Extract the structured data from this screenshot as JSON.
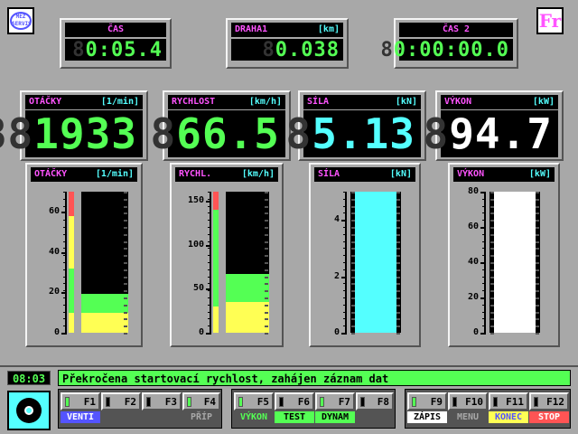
{
  "top": {
    "cas": {
      "label": "ČAS",
      "value": "0:05.4",
      "ghost": "8"
    },
    "draha": {
      "label": "DRAHA1",
      "unit": "[km]",
      "value": "0.038",
      "ghost": "8"
    },
    "cas2": {
      "label": "ČAS 2",
      "value": "0:00:00.0",
      "ghost": "8"
    }
  },
  "big": {
    "otacky": {
      "label": "OTÁČKY",
      "unit": "[1/min]",
      "value": "1933",
      "ghost": "88",
      "color": "#54ff54"
    },
    "rychlost": {
      "label": "RYCHLOST",
      "unit": "[km/h]",
      "value": "66.5",
      "ghost": "8",
      "color": "#54ff54"
    },
    "sila": {
      "label": "SÍLA",
      "unit": "[kN]",
      "value": "5.13",
      "ghost": "8",
      "color": "#54ffff"
    },
    "vykon": {
      "label": "VÝKON",
      "unit": "[kW]",
      "value": "94.7",
      "ghost": "8",
      "color": "#ffffff"
    }
  },
  "gauges": {
    "otacky": {
      "label": "OTÁČKY",
      "unit": "[1/min]",
      "ticks": [
        "60",
        "40",
        "20",
        "0"
      ],
      "max": 70,
      "value": 19.3
    },
    "rychl": {
      "label": "RYCHL.",
      "unit": "[km/h]",
      "ticks": [
        "150",
        "100",
        "50",
        "0"
      ],
      "max": 160,
      "value": 66.5
    },
    "sila": {
      "label": "SÍLA",
      "unit": "[kN]",
      "ticks": [
        "4",
        "2",
        "0"
      ],
      "max": 5,
      "value": 5.13
    },
    "vykon": {
      "label": "VÝKON",
      "unit": "[kW]",
      "ticks": [
        "80",
        "60",
        "40",
        "20",
        "0"
      ],
      "max": 80,
      "value": 94.7
    }
  },
  "status": {
    "clock": "08:03",
    "message": "Překročena startovací rychlost, zahájen záznam dat"
  },
  "fkeys": {
    "f1": "F1",
    "f2": "F2",
    "f3": "F3",
    "f4": "F4",
    "f5": "F5",
    "f6": "F6",
    "f7": "F7",
    "f8": "F8",
    "f9": "F9",
    "f10": "F10",
    "f11": "F11",
    "f12": "F12",
    "venti": "VENTI",
    "prip": "PŘÍP",
    "vykon": "VÝKON",
    "test": "TEST",
    "dynam": "DYNAM",
    "zapis": "ZÁPIS",
    "menu": "MENU",
    "konec": "KONEC",
    "stop": "STOP"
  },
  "colors": {
    "bg": "#a8a8a8",
    "green": "#54ff54",
    "cyan": "#54ffff",
    "magenta": "#ff54ff",
    "yellow": "#ffff54",
    "red": "#ff5454",
    "blue": "#5454ff"
  }
}
